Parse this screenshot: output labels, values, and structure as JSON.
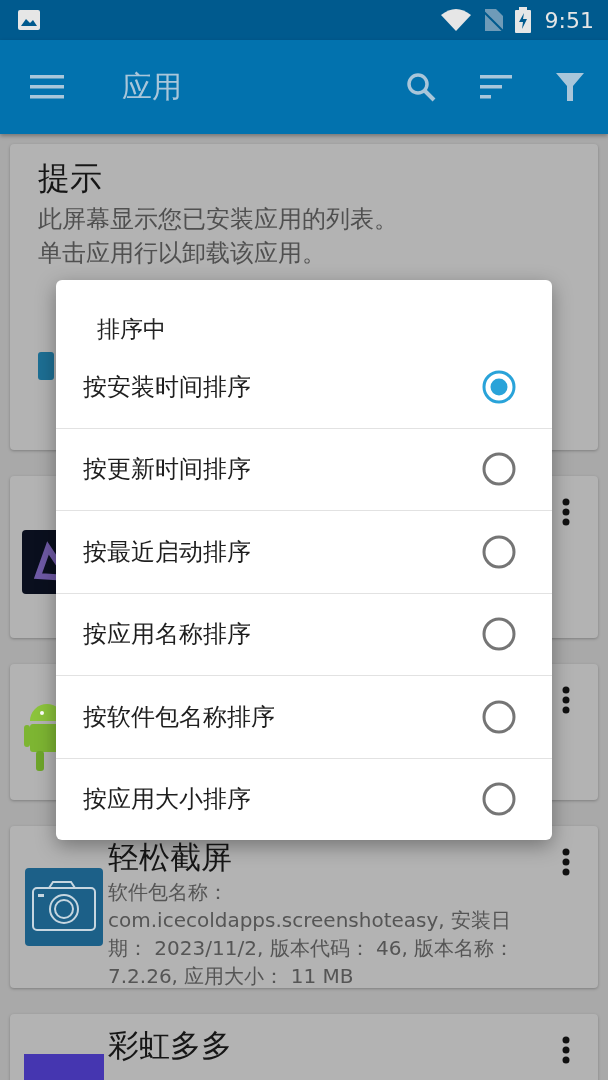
{
  "status_bar": {
    "time": "9:51"
  },
  "app_bar": {
    "title": "应用"
  },
  "hint_card": {
    "title": "提示",
    "lines": [
      "此屏幕显示您已安装应用的列表。",
      "单击应用行以卸载该应用。"
    ]
  },
  "apps": [
    {
      "kind": "dark"
    },
    {
      "kind": "android"
    },
    {
      "kind": "camera",
      "name": "轻松截屏",
      "details": "软件包名称： com.icecoldapps.screenshoteasy, 安装日期： 2023/11/2, 版本代码： 46, 版本名称： 7.2.26, 应用大小： 11 MB"
    },
    {
      "kind": "purple",
      "name": "彩虹多多"
    }
  ],
  "dialog": {
    "title": "排序中",
    "options": [
      {
        "label": "按安装时间排序",
        "selected": true
      },
      {
        "label": "按更新时间排序",
        "selected": false
      },
      {
        "label": "按最近启动排序",
        "selected": false
      },
      {
        "label": "按应用名称排序",
        "selected": false
      },
      {
        "label": "按软件包名称排序",
        "selected": false
      },
      {
        "label": "按应用大小排序",
        "selected": false
      }
    ]
  }
}
